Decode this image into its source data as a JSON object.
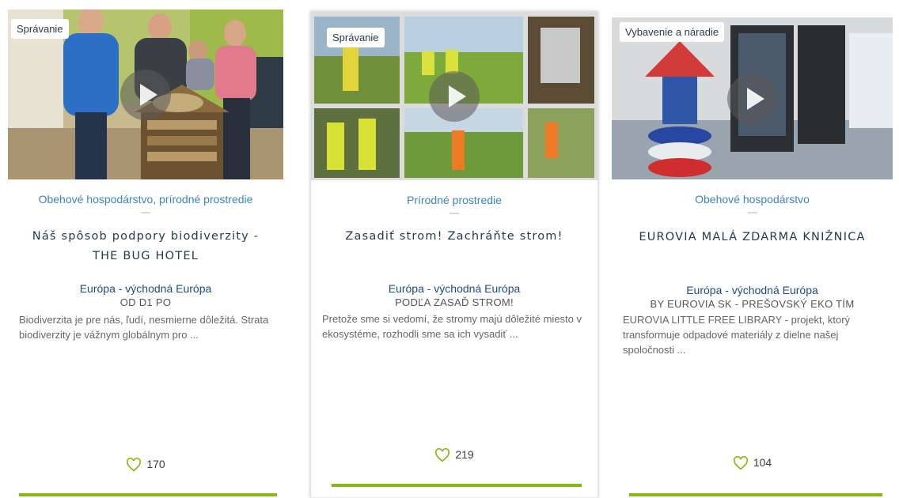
{
  "cards": [
    {
      "tag": "Správanie",
      "category": "Obehové hospodárstvo, prírodné prostredie",
      "title": "Náš spôsob podpory biodiverzity - THE BUG HOTEL",
      "region": "Európa - východná Európa",
      "author": "OD D1 PO",
      "excerpt": "Biodiverzita je pre nás, ľudí, nesmierne dôležitá. Strata biodiverzity je vážnym globálnym pro ...",
      "likes": "170"
    },
    {
      "tag": "Správanie",
      "category": "Prírodné prostredie",
      "title": "Zasadiť strom! Zachráňte strom!",
      "region": "Európa - východná Európa",
      "author": "PODĽA ZASAĎ STROM!",
      "excerpt": "Pretože sme si vedomí, že stromy majú dôležité miesto v ekosystéme, rozhodli sme sa ich vysadiť ...",
      "likes": "219"
    },
    {
      "tag": "Vybavenie a náradie",
      "category": "Obehové hospodárstvo",
      "title": "EUROVIA MALÁ ZDARMA KNIŽNICA",
      "region": "Európa - východná Európa",
      "author": "BY EUROVIA SK - PREŠOVSKÝ EKO TÍM",
      "excerpt": "EUROVIA LITTLE FREE LIBRARY - projekt, ktorý transformuje odpadové materiály z dielne našej spoločnosti ...",
      "likes": "104"
    }
  ],
  "colors": {
    "accent": "#86b816",
    "category": "#3b84bd",
    "region": "#1e4d7a"
  },
  "icons": {
    "like": "heart-icon",
    "video": "play-icon"
  }
}
